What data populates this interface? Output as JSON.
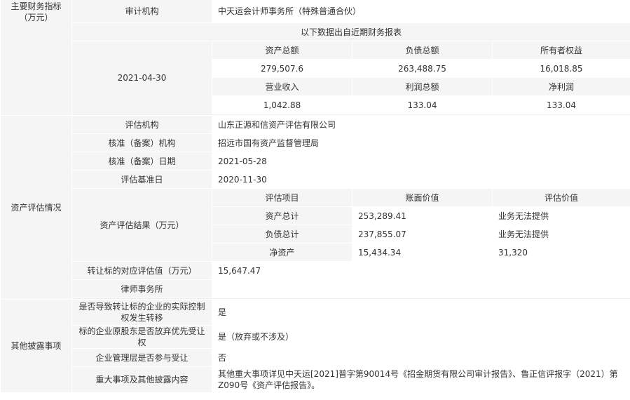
{
  "finance": {
    "section_label": "主要财务指标（万元）",
    "auditor_label": "审计机构",
    "auditor_value": "中天运会计师事务所（特殊普通合伙）",
    "recent_note": "以下数据出自近期财务报表",
    "date": "2021-04-30",
    "headers1": [
      "资产总额",
      "负债总额",
      "所有者权益"
    ],
    "values1": [
      "279,507.6",
      "263,488.75",
      "16,018.85"
    ],
    "headers2": [
      "营业收入",
      "利润总额",
      "净利润"
    ],
    "values2": [
      "1,042.88",
      "133.04",
      "133.04"
    ]
  },
  "assessment": {
    "section_label": "资产评估情况",
    "org_label": "评估机构",
    "org_value": "山东正源和信资产评估有限公司",
    "approval_org_label": "核准（备案）机构",
    "approval_org_value": "招远市国有资产监督管理局",
    "approval_date_label": "核准（备案）日期",
    "approval_date_value": "2021-05-28",
    "base_date_label": "评估基准日",
    "base_date_value": "2020-11-30",
    "result_label": "资产评估结果（万元）",
    "result_headers": [
      "评估项目",
      "账面价值",
      "评估价值"
    ],
    "rows": [
      {
        "item": "资产总计",
        "book": "253,289.41",
        "eval": "业务无法提供"
      },
      {
        "item": "负债总计",
        "book": "237,855.07",
        "eval": "业务无法提供"
      },
      {
        "item": "净资产",
        "book": "15,434.34",
        "eval": "31,320"
      }
    ],
    "target_value_label": "转让标的对应评估值（万元）",
    "target_value": "15,647.47",
    "law_firm_label": "律师事务所",
    "law_firm_value": ""
  },
  "other": {
    "section_label": "其他披露事项",
    "control_change_label": "是否导致转让标的企业的实际控制权发生转移",
    "control_change_value": "是",
    "preemption_label": "标的企业原股东是否放弃优先受让权",
    "preemption_value": "是（放弃或不涉及）",
    "mgmt_label": "企业管理层是否参与受让",
    "mgmt_value": "否",
    "major_label": "重大事项及其他披露内容",
    "major_value": "其他重大事项详见中天运[2021]普字第90014号《招金期货有限公司审计报告》、鲁正信评报字（2021）第Z090号《资产评估报告》。"
  }
}
